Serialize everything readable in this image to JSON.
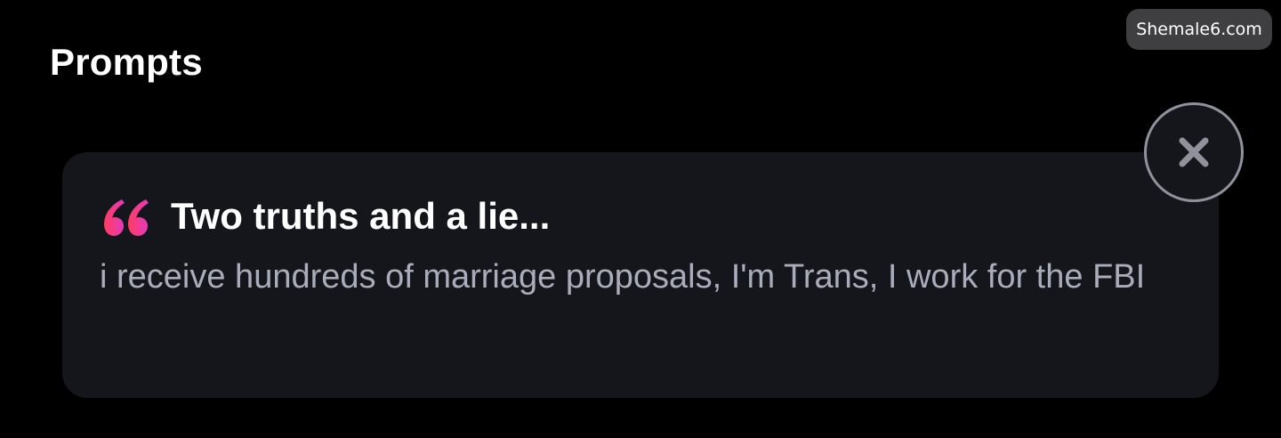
{
  "header": {
    "title": "Prompts"
  },
  "watermark": {
    "text": "Shemale6.com"
  },
  "prompt_card": {
    "title": "Two truths and a lie...",
    "answer": "i receive hundreds of marriage proposals, I'm Trans, I work for the FBI",
    "quote_icon": "quote-icon",
    "close_icon": "close-icon"
  },
  "colors": {
    "background": "#000000",
    "card": "#14161b",
    "title_text": "#ffffff",
    "answer_text": "#a9adbb",
    "quote_gradient_start": "#ff3c5f",
    "quote_gradient_end": "#e23bbf",
    "close_border": "#8f929c",
    "close_icon": "#8f929c",
    "watermark_bg": "#3f3f41"
  }
}
